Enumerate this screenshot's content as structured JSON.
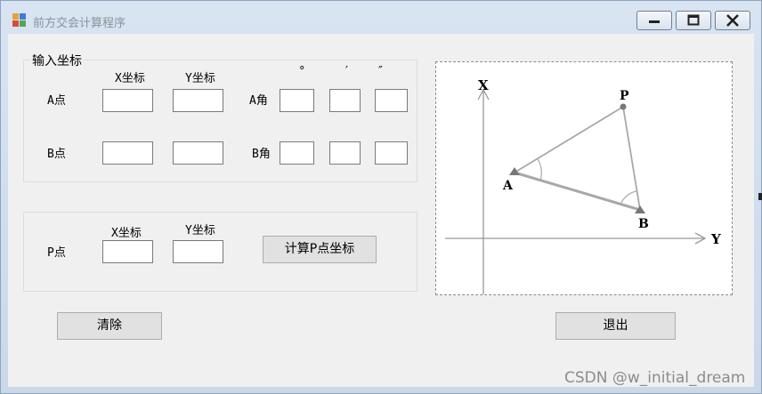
{
  "window": {
    "title": "前方交会计算程序"
  },
  "input_group": {
    "title": "输入坐标",
    "x_header": "X坐标",
    "y_header": "Y坐标",
    "deg_header": "°",
    "min_header": "′",
    "sec_header": "″",
    "point_a_label": "A点",
    "point_b_label": "B点",
    "angle_a_label": "A角",
    "angle_b_label": "B角",
    "a_x": "",
    "a_y": "",
    "b_x": "",
    "b_y": "",
    "angle_a_deg": "",
    "angle_a_min": "",
    "angle_a_sec": "",
    "angle_b_deg": "",
    "angle_b_min": "",
    "angle_b_sec": ""
  },
  "result_group": {
    "x_header": "X坐标",
    "y_header": "Y坐标",
    "point_p_label": "P点",
    "p_x": "",
    "p_y": "",
    "calc_button": "计算P点坐标"
  },
  "buttons": {
    "clear": "清除",
    "exit": "退出"
  },
  "diagram": {
    "axis_x": "X",
    "axis_y": "Y",
    "point_a": "A",
    "point_b": "B",
    "point_p": "P"
  },
  "watermark": "CSDN @w_initial_dream",
  "colors": {
    "client_bg": "#f0f0f0",
    "button_bg": "#e1e1e1",
    "titlebar_bg": "#d8e4f2"
  }
}
